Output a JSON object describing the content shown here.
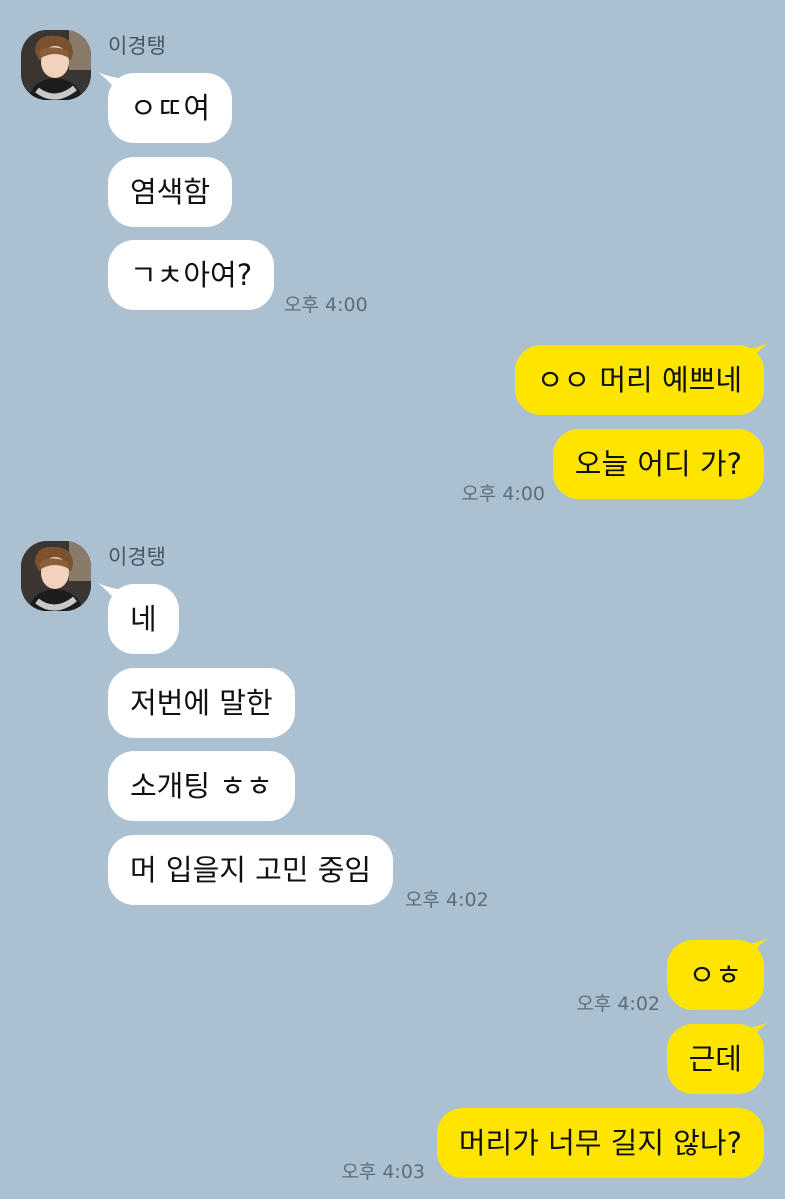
{
  "chat": {
    "colors": {
      "background": "#abc1d1",
      "incoming_bubble": "#ffffff",
      "outgoing_bubble": "#fee500",
      "timestamp": "#5d6d7a"
    },
    "groups": [
      {
        "sender": "이경탱",
        "avatar": "profile-photo",
        "messages": [
          "ㅇㄸ여",
          "염색함",
          "ㄱㅊ아여?"
        ],
        "time": "오후 4:00"
      },
      {
        "messages": [
          "ㅇㅇ 머리 예쁘네",
          "오늘 어디 가?"
        ],
        "time": "오후 4:00"
      },
      {
        "sender": "이경탱",
        "avatar": "profile-photo",
        "messages": [
          "네",
          "저번에 말한",
          "소개팅 ㅎㅎ",
          "머 입을지 고민 중임"
        ],
        "time": "오후 4:02"
      },
      {
        "messages": [
          "ㅇㅎ"
        ],
        "time": "오후 4:02"
      },
      {
        "messages": [
          "근데",
          "머리가 너무 길지 않나?"
        ],
        "time": "오후 4:03"
      }
    ]
  }
}
